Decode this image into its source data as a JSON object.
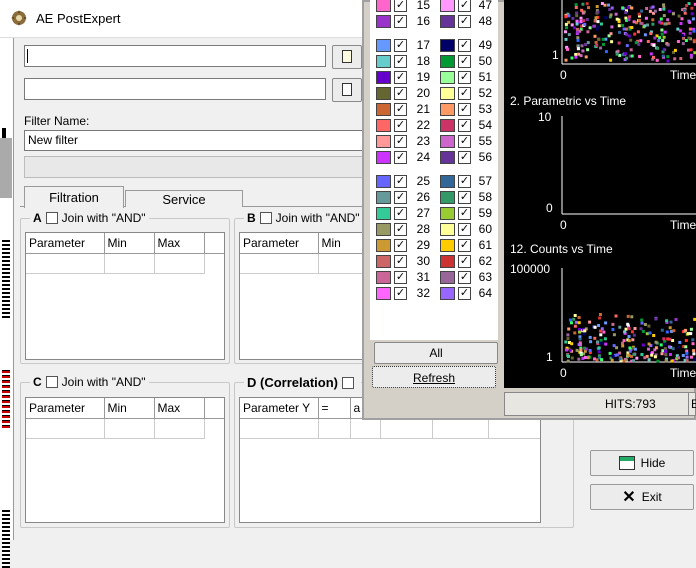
{
  "app": {
    "title": "AE PostExpert"
  },
  "filter": {
    "name_label": "Filter Name:",
    "name_value": "New filter"
  },
  "tabs": [
    {
      "label": "Filtration"
    },
    {
      "label": "Service"
    }
  ],
  "groups": {
    "a": {
      "label": "A",
      "join": "Join with \"AND\"",
      "columns": [
        "Parameter",
        "Min",
        "Max"
      ]
    },
    "b": {
      "label": "B",
      "join": "Join with \"AND\"",
      "columns": [
        "Parameter",
        "Min"
      ]
    },
    "c": {
      "label": "C",
      "join": "Join with \"AND\"",
      "columns": [
        "Parameter",
        "Min",
        "Max"
      ]
    },
    "d": {
      "label": "D (Correlation)",
      "columns": [
        "Parameter Y",
        "=",
        "a"
      ]
    }
  },
  "colors": {
    "left_column": [
      {
        "n": "15",
        "color": "#ff66cc"
      },
      {
        "n": "16",
        "color": "#9933cc"
      },
      {
        "n": "17",
        "color": "#6699ff"
      },
      {
        "n": "18",
        "color": "#66cccc"
      },
      {
        "n": "19",
        "color": "#6600cc"
      },
      {
        "n": "20",
        "color": "#666633"
      },
      {
        "n": "21",
        "color": "#cc6633"
      },
      {
        "n": "22",
        "color": "#ff6666"
      },
      {
        "n": "23",
        "color": "#ff9999"
      },
      {
        "n": "24",
        "color": "#cc33ff"
      },
      {
        "n": "25",
        "color": "#6666ff"
      },
      {
        "n": "26",
        "color": "#669999"
      },
      {
        "n": "27",
        "color": "#33cc99"
      },
      {
        "n": "28",
        "color": "#999966"
      },
      {
        "n": "29",
        "color": "#cc9933"
      },
      {
        "n": "30",
        "color": "#cc6666"
      },
      {
        "n": "31",
        "color": "#cc6699"
      },
      {
        "n": "32",
        "color": "#ff66ff"
      }
    ],
    "right_column": [
      {
        "n": "47",
        "color": "#ff99ff"
      },
      {
        "n": "48",
        "color": "#663399"
      },
      {
        "n": "49",
        "color": "#000066"
      },
      {
        "n": "50",
        "color": "#009933"
      },
      {
        "n": "51",
        "color": "#99ff99"
      },
      {
        "n": "52",
        "color": "#ffff99"
      },
      {
        "n": "53",
        "color": "#ff9966"
      },
      {
        "n": "54",
        "color": "#cc3366"
      },
      {
        "n": "55",
        "color": "#cc66cc"
      },
      {
        "n": "56",
        "color": "#663399"
      },
      {
        "n": "57",
        "color": "#336699"
      },
      {
        "n": "58",
        "color": "#339966"
      },
      {
        "n": "59",
        "color": "#99cc33"
      },
      {
        "n": "60",
        "color": "#ffff99"
      },
      {
        "n": "61",
        "color": "#ffcc00"
      },
      {
        "n": "62",
        "color": "#cc3333"
      },
      {
        "n": "63",
        "color": "#996699"
      },
      {
        "n": "64",
        "color": "#9966ff"
      }
    ],
    "all_label": "All",
    "refresh_label": "Refresh"
  },
  "plots": [
    {
      "title": "",
      "y_bottom": "1",
      "x_start": "0",
      "x_axis": "Time"
    },
    {
      "title": "2. Parametric vs Time",
      "y_top": "10",
      "y_bottom": "0",
      "x_start": "0",
      "x_axis": "Time"
    },
    {
      "title": "12. Counts vs Time",
      "y_top": "100000",
      "y_bottom": "1",
      "x_start": "0",
      "x_axis": "Time"
    }
  ],
  "status": {
    "hits": "HITS:793",
    "extra": "E"
  },
  "buttons": {
    "hide": "Hide",
    "exit": "Exit"
  }
}
